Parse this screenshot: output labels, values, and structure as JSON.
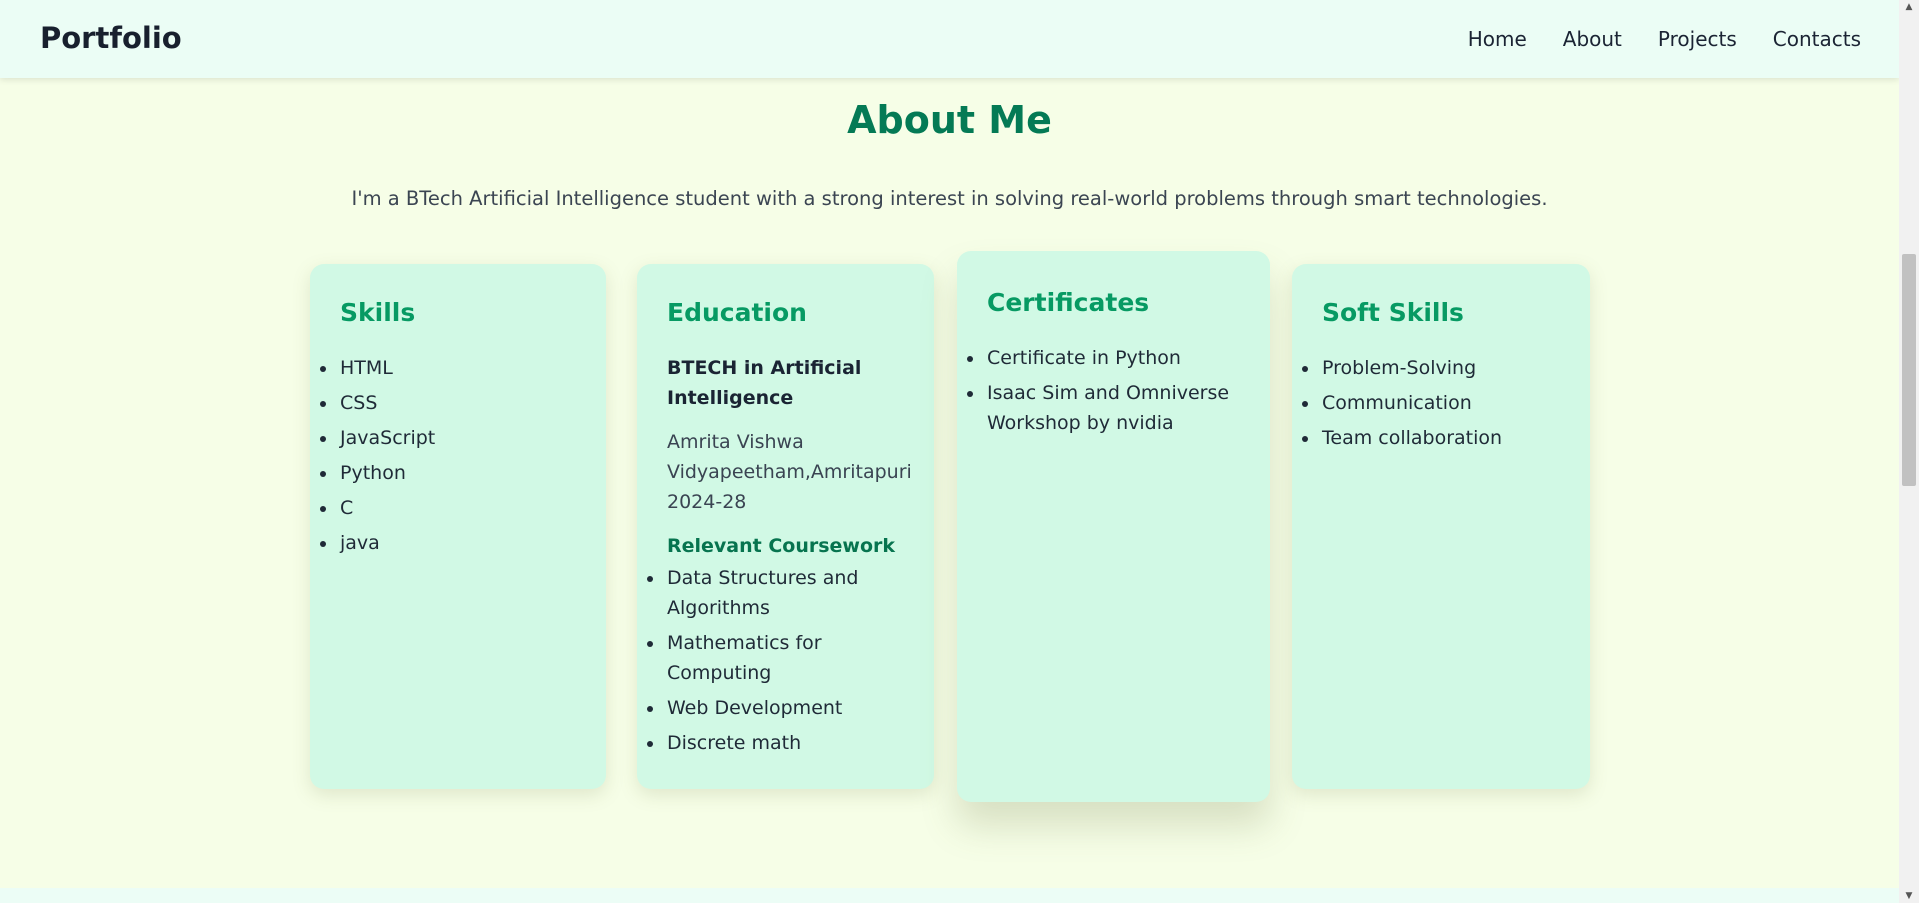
{
  "nav": {
    "brand": "Portfolio",
    "links": [
      "Home",
      "About",
      "Projects",
      "Contacts"
    ]
  },
  "about": {
    "title": "About Me",
    "intro": "I'm a BTech Artificial Intelligence student with a strong interest in solving real-world problems through smart technologies.",
    "cards": {
      "skills": {
        "title": "Skills",
        "items": [
          "HTML",
          "CSS",
          "JavaScript",
          "Python",
          "C",
          "java"
        ]
      },
      "education": {
        "title": "Education",
        "degree": "BTECH in Artificial Intelligence",
        "school": "Amrita Vishwa Vidyapeetham,Amritapuri 2024-28",
        "coursework_title": "Relevant Coursework",
        "coursework": [
          "Data Structures and Algorithms",
          "Mathematics for Computing",
          "Web Development",
          "Discrete math"
        ]
      },
      "certificates": {
        "title": "Certificates",
        "items": [
          "Certificate in Python",
          "Isaac Sim and Omniverse Workshop by nvidia"
        ]
      },
      "soft_skills": {
        "title": "Soft Skills",
        "items": [
          "Problem-Solving",
          "Communication",
          "Team collaboration"
        ]
      }
    }
  },
  "colors": {
    "page_background": "#f6fee7",
    "navbar_background": "#ebfdf5",
    "card_background": "#d1f9e5",
    "accent_green": "#079a63",
    "title_green": "#047a55"
  },
  "scrollbar": {
    "up_icon": "scroll-up-arrow-icon",
    "down_icon": "scroll-down-arrow-icon"
  }
}
